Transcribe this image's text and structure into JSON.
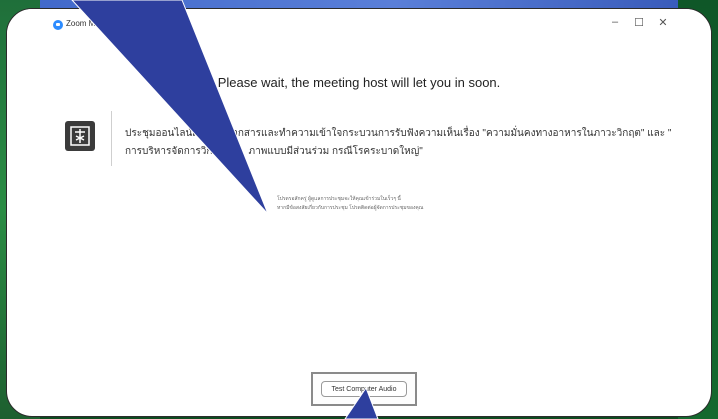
{
  "window": {
    "app_title": "Zoom M",
    "minimize_glyph": "–",
    "maximize_glyph": "☐",
    "close_glyph": "✕"
  },
  "main": {
    "wait_message": "Please wait, the meeting host will let you in soon.",
    "topic_line1": "ประชุมออนไลน์เ             อกสารและทำความเข้าใจกระบวนการรับฟังความเห็นเรื่อง \"ความมั่นคงทางอาหารในภาวะวิกฤต\" และ \"",
    "topic_line2": "การบริหารจัดการวิก             ภาพแบบมีส่วนร่วม กรณีโรคระบาดใหญ่\"",
    "description_line1": "โปรดรอสักครู่ ผู้ดูแลการประชุมจะให้คุณเข้าร่วมในเร็วๆ นี้",
    "description_line2": "หากมีข้อสงสัยเกี่ยวกับการประชุม โปรดติดต่อผู้จัดการประชุมของคุณ"
  },
  "footer": {
    "test_audio_label": "Test Computer Audio"
  },
  "colors": {
    "pointer": "#2e3f9e",
    "highlight_box": "#8a8a8a",
    "zoom_blue": "#2d8cff"
  },
  "icons": {
    "app": "zoom-app-icon",
    "logo": "meeting-logo-icon",
    "pointer": "annotation-arrow-icon"
  }
}
